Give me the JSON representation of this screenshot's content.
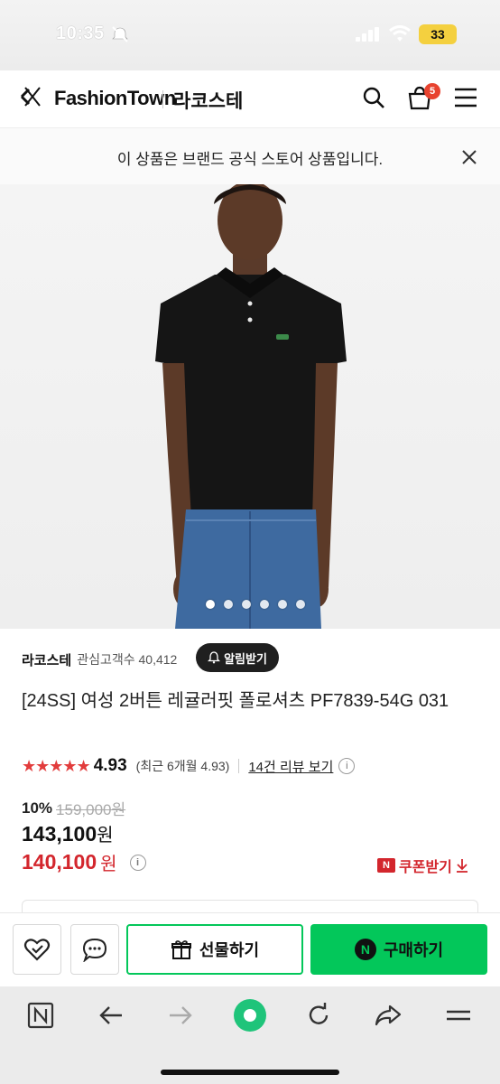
{
  "status_bar": {
    "time": "10:35",
    "battery": "33"
  },
  "header": {
    "brand": "FashionTown",
    "shop": "라코스테",
    "cart_count": "5"
  },
  "notice": {
    "text": "이 상품은 브랜드 공식 스토어 상품입니다."
  },
  "gallery": {
    "total_images": 6,
    "active_index": 0
  },
  "product": {
    "brand": "라코스테",
    "followers_label": "관심고객수 40,412",
    "alarm_label": "알림받기",
    "title": "[24SS] 여성 2버튼 레귤러핏 폴로셔츠 PF7839-54G 031",
    "stars": "★★★★★",
    "rating": "4.93",
    "recent_rating": "(최근 6개월 4.93)",
    "reviews_link": "14건 리뷰 보기",
    "discount": "10%",
    "original_price": "159,000원",
    "price": "143,100",
    "price_unit": "원",
    "coupon_price": "140,100",
    "coupon_unit": "원",
    "coupon_button": "쿠폰받기",
    "coupon_badge": "N"
  },
  "action_bar": {
    "gift_label": "선물하기",
    "buy_label": "구매하기",
    "buy_badge": "N"
  },
  "toolbar": {
    "n_label": "N"
  },
  "colors": {
    "naver_green": "#03c75a",
    "sale_red": "#d3262d",
    "star_red": "#e23c3c"
  }
}
